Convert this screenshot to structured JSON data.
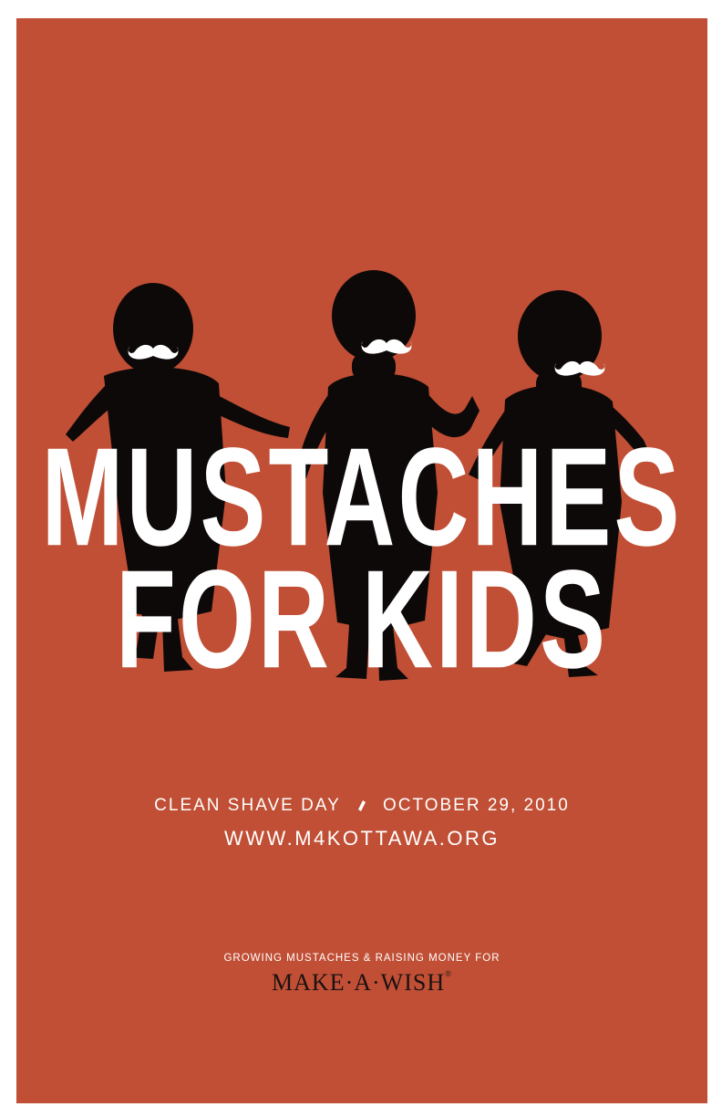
{
  "poster": {
    "background_color": "#c04f35",
    "silhouette_color": "#0d0908",
    "text_color": "#ffffff",
    "headline_line1": "MUSTACHES",
    "headline_line2": "FOR KIDS",
    "event_name": "CLEAN SHAVE DAY",
    "event_date": "OCTOBER 29, 2010",
    "website": "WWW.M4KOTTAWA.ORG",
    "tagline": "GROWING MUSTACHES & RAISING MONEY FOR",
    "logo_text": "MAKE·A·WISH",
    "logo_mark": "®",
    "illustration": "three-toddler-silhouettes-with-mustaches",
    "separator_icon": "slash-diamond-icon"
  }
}
